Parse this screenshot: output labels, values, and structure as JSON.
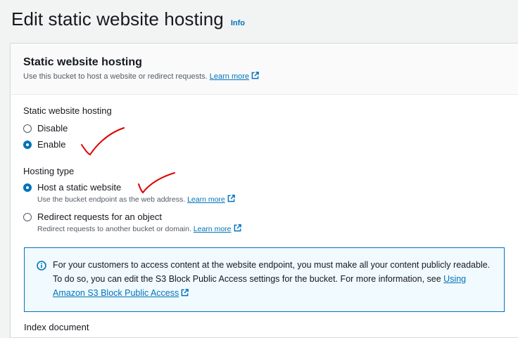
{
  "page": {
    "title": "Edit static website hosting",
    "info_label": "Info"
  },
  "panel": {
    "title": "Static website hosting",
    "description": "Use this bucket to host a website or redirect requests.",
    "learn_more": "Learn more"
  },
  "hosting": {
    "label": "Static website hosting",
    "options": [
      {
        "label": "Disable",
        "checked": false
      },
      {
        "label": "Enable",
        "checked": true
      }
    ]
  },
  "hosting_type": {
    "label": "Hosting type",
    "options": [
      {
        "label": "Host a static website",
        "description": "Use the bucket endpoint as the web address.",
        "learn_more": "Learn more",
        "checked": true
      },
      {
        "label": "Redirect requests for an object",
        "description": "Redirect requests to another bucket or domain.",
        "learn_more": "Learn more",
        "checked": false
      }
    ]
  },
  "alert": {
    "text": "For your customers to access content at the website endpoint, you must make all your content publicly readable. To do so, you can edit the S3 Block Public Access settings for the bucket. For more information, see",
    "link": "Using Amazon S3 Block Public Access"
  },
  "next_section": {
    "label": "Index document"
  },
  "colors": {
    "link": "#0073bb",
    "annotation": "#e00000",
    "alert_bg": "#f1faff"
  },
  "icons": {
    "external": "external-link-icon",
    "info": "info-circle-icon"
  }
}
